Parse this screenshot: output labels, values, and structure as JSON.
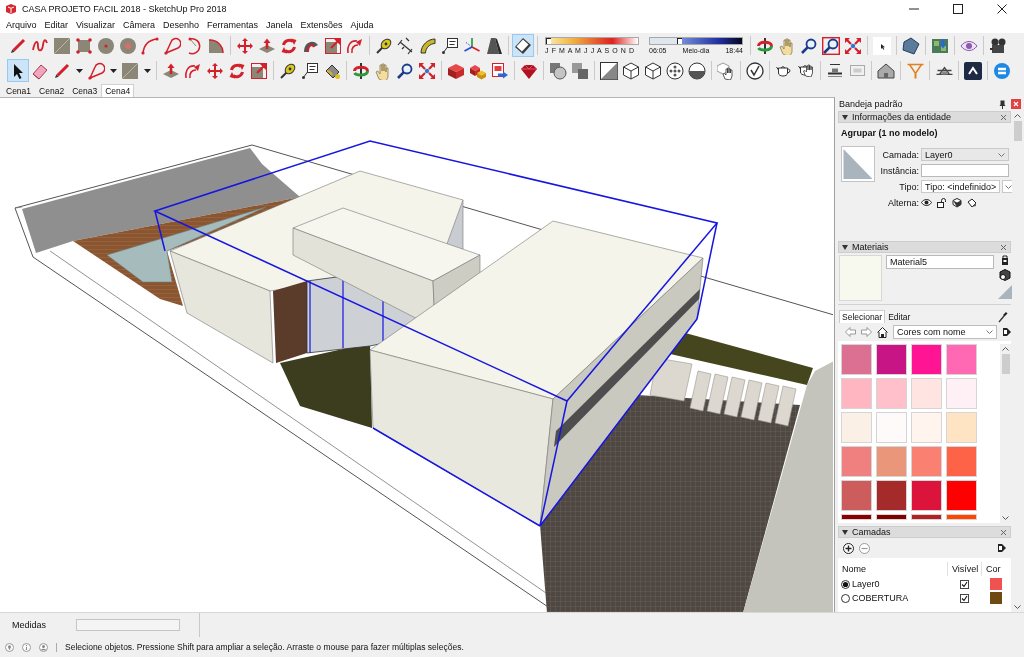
{
  "window": {
    "title": "CASA PROJETO FACIL 2018 - SketchUp Pro 2018"
  },
  "menu": [
    "Arquivo",
    "Editar",
    "Visualizar",
    "Câmera",
    "Desenho",
    "Ferramentas",
    "Janela",
    "Extensões",
    "Ajuda"
  ],
  "toolbars": [
    {
      "groups": [
        {
          "kind": "tools",
          "tools": [
            {
              "kind": "pencil",
              "selected": false
            },
            {
              "kind": "squiggle",
              "selected": false
            },
            {
              "kind": "rectangle",
              "selected": false
            },
            {
              "kind": "dotrect",
              "selected": false
            },
            {
              "kind": "circle",
              "selected": false
            },
            {
              "kind": "polygon",
              "selected": false
            },
            {
              "kind": "arc",
              "selected": false
            },
            {
              "kind": "bulb",
              "selected": false
            },
            {
              "kind": "hook",
              "selected": false
            },
            {
              "kind": "pie",
              "selected": false
            }
          ]
        },
        {
          "kind": "tools",
          "tools": [
            {
              "kind": "move",
              "selected": false
            },
            {
              "kind": "pushpull",
              "selected": false
            },
            {
              "kind": "rotate",
              "selected": false
            },
            {
              "kind": "followme",
              "selected": false
            },
            {
              "kind": "scale",
              "selected": false
            },
            {
              "kind": "offset",
              "selected": false
            }
          ]
        },
        {
          "kind": "tools",
          "tools": [
            {
              "kind": "tape",
              "selected": false
            },
            {
              "kind": "dimension",
              "selected": false
            },
            {
              "kind": "protractor",
              "selected": false
            },
            {
              "kind": "textlabel",
              "selected": false
            },
            {
              "kind": "axes",
              "selected": false
            },
            {
              "kind": "text3d",
              "selected": false
            }
          ]
        },
        {
          "kind": "tools",
          "tools": [
            {
              "kind": "shadows",
              "selected": true
            }
          ]
        },
        {
          "kind": "shadows",
          "months": "J F M A M J J A S O N D",
          "date_slider": {
            "level": 0
          },
          "time_slider": {
            "level": 0.31
          },
          "time_start": "06:05",
          "time_noon": "Meio-dia",
          "time_end": "18:44"
        },
        {
          "kind": "tools",
          "tools": [
            {
              "kind": "orbit",
              "selected": false
            },
            {
              "kind": "pan",
              "selected": false
            },
            {
              "kind": "zoom",
              "selected": false
            },
            {
              "kind": "zoomwindow",
              "selected": false
            },
            {
              "kind": "zoomextents",
              "selected": false
            }
          ]
        },
        {
          "kind": "tools",
          "tools": [
            {
              "kind": "cursor",
              "selected": false
            }
          ]
        },
        {
          "kind": "tools",
          "tools": [
            {
              "kind": "gem",
              "selected": false
            }
          ]
        },
        {
          "kind": "tools",
          "tools": [
            {
              "kind": "map",
              "selected": false
            }
          ]
        },
        {
          "kind": "tools",
          "tools": [
            {
              "kind": "eye",
              "selected": false
            }
          ]
        },
        {
          "kind": "tools",
          "tools": [
            {
              "kind": "camera",
              "selected": false
            }
          ]
        }
      ]
    },
    {
      "groups": [
        {
          "kind": "tools",
          "tools": [
            {
              "kind": "select",
              "selected": true
            },
            {
              "kind": "eraser",
              "selected": false
            },
            {
              "kind": "pencil",
              "selected": false
            },
            {
              "kind": "caret",
              "selected": false
            },
            {
              "kind": "bulb",
              "selected": false
            },
            {
              "kind": "caret",
              "selected": false
            },
            {
              "kind": "rectangle",
              "selected": false
            },
            {
              "kind": "caret",
              "selected": false
            }
          ]
        },
        {
          "kind": "tools",
          "tools": [
            {
              "kind": "pushpull",
              "selected": false
            },
            {
              "kind": "offset",
              "selected": false
            },
            {
              "kind": "move",
              "selected": false
            },
            {
              "kind": "rotate",
              "selected": false
            },
            {
              "kind": "scale",
              "selected": false
            }
          ]
        },
        {
          "kind": "tools",
          "tools": [
            {
              "kind": "tape",
              "selected": false
            },
            {
              "kind": "textlabel",
              "selected": false
            },
            {
              "kind": "paint",
              "selected": false
            }
          ]
        },
        {
          "kind": "tools",
          "tools": [
            {
              "kind": "orbit",
              "selected": false
            },
            {
              "kind": "pan",
              "selected": false
            },
            {
              "kind": "zoom",
              "selected": false
            },
            {
              "kind": "zoomextents",
              "selected": false
            }
          ]
        },
        {
          "kind": "tools",
          "tools": [
            {
              "kind": "warehouse",
              "selected": false
            },
            {
              "kind": "components",
              "selected": false
            },
            {
              "kind": "layout",
              "selected": false
            }
          ]
        },
        {
          "kind": "tools",
          "tools": [
            {
              "kind": "ruby",
              "selected": false
            }
          ]
        },
        {
          "kind": "tools",
          "tools": [
            {
              "kind": "shell",
              "selected": false
            },
            {
              "kind": "intersect",
              "selected": false
            }
          ]
        },
        {
          "kind": "tools",
          "tools": [
            {
              "kind": "xray",
              "selected": false
            },
            {
              "kind": "cube",
              "selected": false
            },
            {
              "kind": "cube",
              "selected": false
            },
            {
              "kind": "sphere",
              "selected": false
            },
            {
              "kind": "halfsphere",
              "selected": false
            }
          ]
        },
        {
          "kind": "tools",
          "tools": [
            {
              "kind": "handcube",
              "selected": false
            }
          ]
        },
        {
          "kind": "tools",
          "tools": [
            {
              "kind": "check",
              "selected": false
            }
          ]
        },
        {
          "kind": "tools",
          "tools": [
            {
              "kind": "teapot",
              "selected": false
            },
            {
              "kind": "teapothand",
              "selected": false
            }
          ]
        },
        {
          "kind": "tools",
          "tools": [
            {
              "kind": "section",
              "selected": false
            },
            {
              "kind": "sectionfaded",
              "selected": false
            }
          ]
        },
        {
          "kind": "tools",
          "tools": [
            {
              "kind": "house",
              "selected": false
            }
          ]
        },
        {
          "kind": "tools",
          "tools": [
            {
              "kind": "sandbox",
              "selected": false
            }
          ]
        },
        {
          "kind": "tools",
          "tools": [
            {
              "kind": "roof",
              "selected": false
            }
          ]
        },
        {
          "kind": "tools",
          "tools": [
            {
              "kind": "chevron",
              "selected": false
            }
          ]
        },
        {
          "kind": "tools",
          "tools": [
            {
              "kind": "logo",
              "selected": false
            }
          ]
        }
      ]
    }
  ],
  "scenes": [
    {
      "label": "Cena1",
      "selected": false
    },
    {
      "label": "Cena2",
      "selected": false
    },
    {
      "label": "Cena3",
      "selected": false
    },
    {
      "label": "Cena4",
      "selected": true
    }
  ],
  "tray": {
    "title": "Bandeja padrão",
    "entity_info": {
      "title": "Informações da entidade",
      "expanded": true,
      "heading": "Agrupar (1 no modelo)",
      "fields": [
        {
          "label": "Camada:",
          "kind": "dropdown",
          "value": "Layer0"
        },
        {
          "label": "Instância:",
          "kind": "input"
        },
        {
          "label": "Tipo:",
          "kind": "combo",
          "value": "Tipo: <indefinido>"
        },
        {
          "label": "Alterna:",
          "kind": "toggles"
        }
      ]
    },
    "materials": {
      "title": "Materiais",
      "expanded": true,
      "name": "Material5",
      "tabs": [
        {
          "label": "Selecionar",
          "selected": true
        },
        {
          "label": "Editar",
          "selected": false
        }
      ],
      "library": "Cores com nome",
      "swatches": [
        {
          "color": "#db7093"
        },
        {
          "color": "#c71585"
        },
        {
          "color": "#ff1493"
        },
        {
          "color": "#ff69b4"
        },
        {
          "color": "#ffb6c1"
        },
        {
          "color": "#ffc0cb"
        },
        {
          "color": "#ffe4e1"
        },
        {
          "color": "#fff0f5"
        },
        {
          "color": "#faf0e6"
        },
        {
          "color": "#fffafa"
        },
        {
          "color": "#fff5ee"
        },
        {
          "color": "#ffe4c4"
        },
        {
          "color": "#f08080"
        },
        {
          "color": "#e9967a"
        },
        {
          "color": "#fa8072"
        },
        {
          "color": "#ff6347"
        },
        {
          "color": "#cd5c5c"
        },
        {
          "color": "#a52a2a"
        },
        {
          "color": "#dc143c"
        },
        {
          "color": "#ff0000"
        },
        {
          "color": "#8b0000"
        },
        {
          "color": "#800000"
        },
        {
          "color": "#b22222"
        },
        {
          "color": "#ff4500"
        }
      ]
    },
    "layers": {
      "title": "Camadas",
      "expanded": true,
      "columns": [
        "Nome",
        "Visível",
        "Cor"
      ],
      "rows": [
        {
          "name": "Layer0",
          "selected": true,
          "visible": true,
          "color": "#f05252"
        },
        {
          "name": "COBERTURA",
          "selected": false,
          "visible": true,
          "color": "#6e4a12"
        }
      ]
    }
  },
  "measurements": {
    "label": "Medidas"
  },
  "status_bar": {
    "text": "Selecione objetos. Pressione Shift para ampliar a seleção. Arraste o mouse para fazer múltiplas seleções."
  }
}
